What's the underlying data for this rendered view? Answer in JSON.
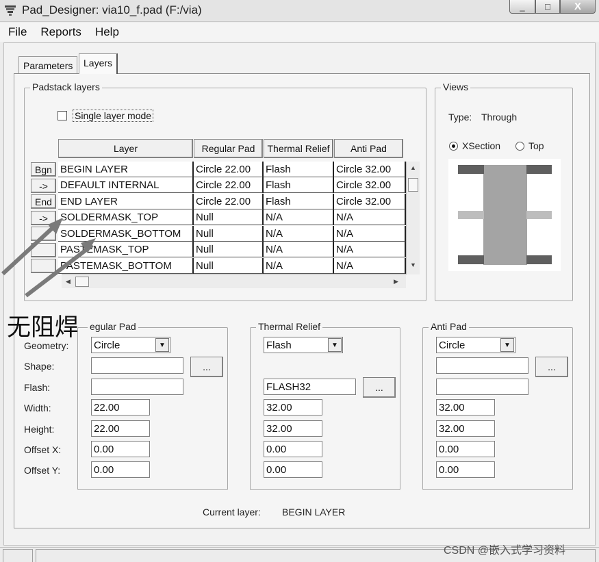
{
  "window": {
    "title": "Pad_Designer: via10_f.pad (F:/via)",
    "minimize": "_",
    "maximize": "□",
    "close": "X"
  },
  "menu": [
    "File",
    "Reports",
    "Help"
  ],
  "tabs": [
    {
      "label": "Parameters",
      "active": false
    },
    {
      "label": "Layers",
      "active": true
    }
  ],
  "padstack": {
    "group_title": "Padstack layers",
    "single_layer_mode": {
      "label": "Single layer mode",
      "checked": false
    },
    "columns": [
      "Layer",
      "Regular Pad",
      "Thermal Relief",
      "Anti Pad"
    ],
    "rows": [
      {
        "btn": "Bgn",
        "layer": "BEGIN LAYER",
        "regular": "Circle 22.00",
        "thermal": "Flash",
        "anti": "Circle 32.00"
      },
      {
        "btn": "->",
        "layer": "DEFAULT INTERNAL",
        "regular": "Circle 22.00",
        "thermal": "Flash",
        "anti": "Circle 32.00"
      },
      {
        "btn": "End",
        "layer": "END LAYER",
        "regular": "Circle 22.00",
        "thermal": "Flash",
        "anti": "Circle 32.00"
      },
      {
        "btn": "->",
        "layer": "SOLDERMASK_TOP",
        "regular": "Null",
        "thermal": "N/A",
        "anti": "N/A"
      },
      {
        "btn": "",
        "layer": "SOLDERMASK_BOTTOM",
        "regular": "Null",
        "thermal": "N/A",
        "anti": "N/A"
      },
      {
        "btn": "",
        "layer": "PASTEMASK_TOP",
        "regular": "Null",
        "thermal": "N/A",
        "anti": "N/A"
      },
      {
        "btn": "",
        "layer": "PASTEMASK_BOTTOM",
        "regular": "Null",
        "thermal": "N/A",
        "anti": "N/A"
      }
    ]
  },
  "views": {
    "group_title": "Views",
    "type_label": "Type:",
    "type_value": "Through",
    "xsection_label": "XSection",
    "top_label": "Top",
    "selected": "XSection"
  },
  "annotation": "无阻焊",
  "labels": {
    "geometry": "Geometry:",
    "shape": "Shape:",
    "flash": "Flash:",
    "width": "Width:",
    "height": "Height:",
    "offset_x": "Offset X:",
    "offset_y": "Offset Y:"
  },
  "regular_pad": {
    "group_title": "egular Pad",
    "geometry": "Circle",
    "shape": "",
    "flash": "",
    "width": "22.00",
    "height": "22.00",
    "offset_x": "0.00",
    "offset_y": "0.00"
  },
  "thermal_relief": {
    "group_title": "Thermal Relief",
    "geometry": "Flash",
    "flash": "FLASH32",
    "width": "32.00",
    "height": "32.00",
    "offset_x": "0.00",
    "offset_y": "0.00"
  },
  "anti_pad": {
    "group_title": "Anti Pad",
    "geometry": "Circle",
    "shape": "",
    "flash": "",
    "width": "32.00",
    "height": "32.00",
    "offset_x": "0.00",
    "offset_y": "0.00"
  },
  "browse_label": "...",
  "current_layer": {
    "label": "Current layer:",
    "value": "BEGIN LAYER"
  },
  "watermark": "CSDN @嵌入式学习资料",
  "colors": {
    "pad_dark": "#5f5f5f",
    "pad_light": "#bdbdbd",
    "drill": "#a4a4a4"
  }
}
